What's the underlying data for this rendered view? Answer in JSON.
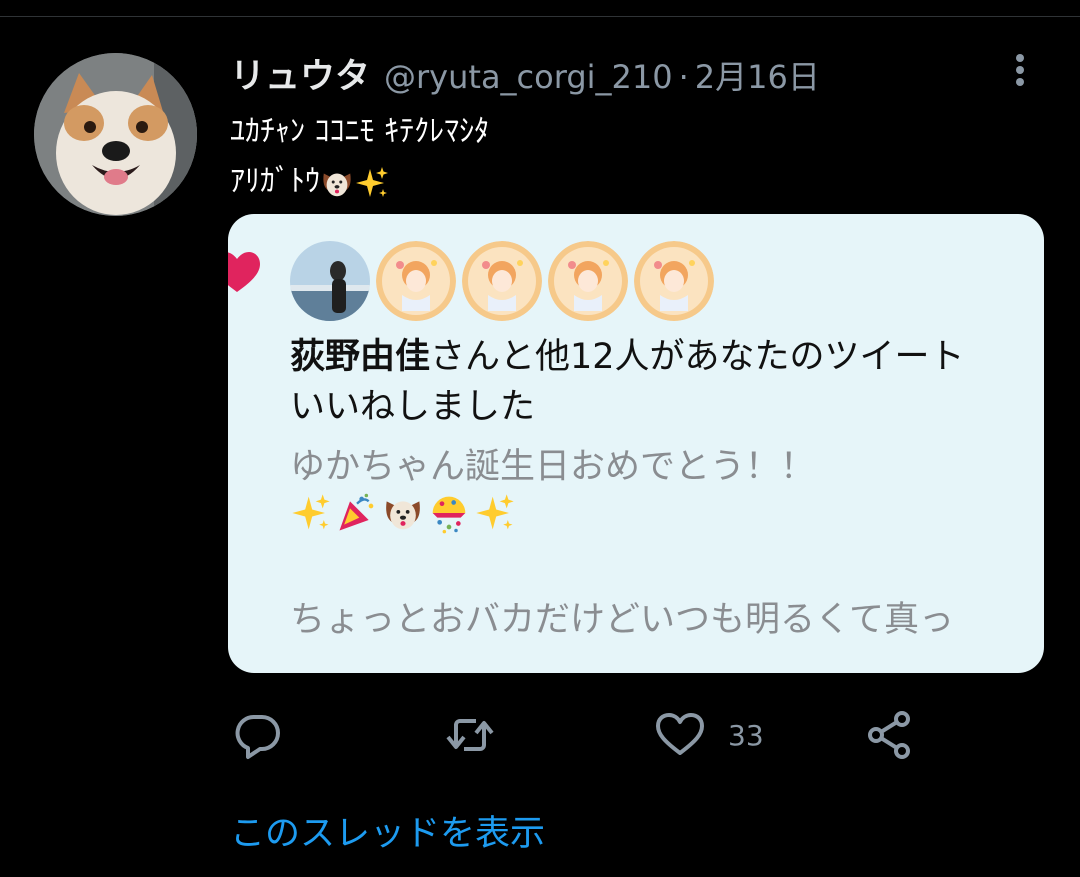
{
  "tweet": {
    "display_name": "リュウタ",
    "handle": "@ryuta_corgi_210",
    "separator": "·",
    "date": "2月16日",
    "text_line1": "ﾕｶﾁｬﾝ ｺｺﾆﾓ ｷﾃｸﾚﾏｼﾀ",
    "text_line2": "ｱﾘｶﾞﾄｳ"
  },
  "card": {
    "liker_name": "荻野由佳",
    "like_message_rest": "さんと他12人があなたのツイート",
    "like_message_line2": "いいねしました",
    "quote_line1": "ゆかちゃん誕生日おめでとう！！",
    "quote_line2": "ちょっとおバカだけどいつも明るくて真っ"
  },
  "actions": {
    "like_count": "33",
    "show_thread": "このスレッドを表示"
  },
  "colors": {
    "background": "#000000",
    "card_bg": "#e6f5f9",
    "muted": "#8b98a5",
    "link": "#1d9bf0",
    "heart": "#e0245e"
  },
  "icons": [
    "more-vertical-icon",
    "reply-icon",
    "retweet-icon",
    "heart-icon",
    "share-icon",
    "dog-face-emoji",
    "sparkles-emoji",
    "party-popper-emoji",
    "confetti-ball-emoji"
  ]
}
